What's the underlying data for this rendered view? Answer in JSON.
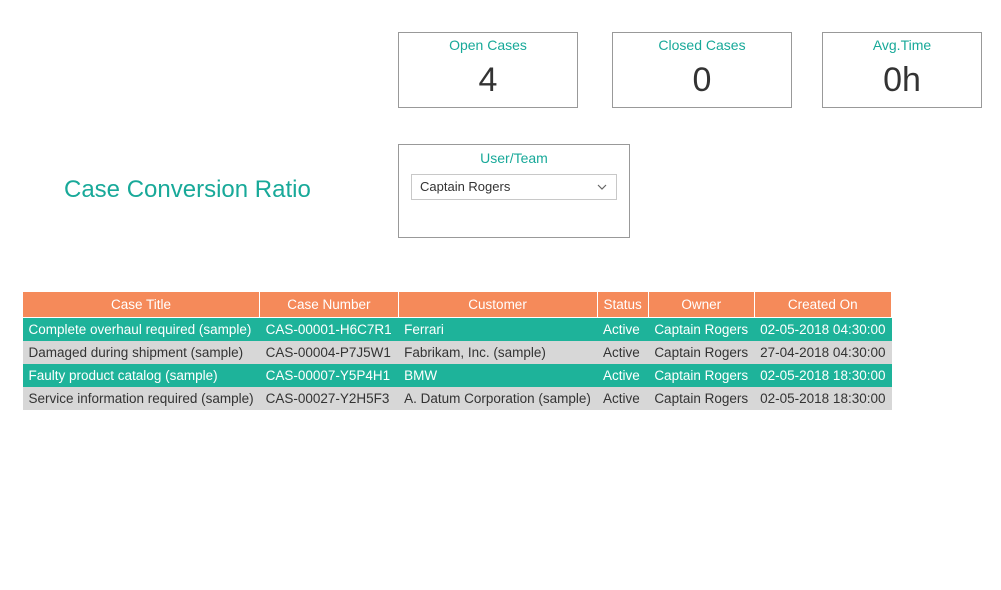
{
  "cards": {
    "open": {
      "label": "Open Cases",
      "value": "4"
    },
    "closed": {
      "label": "Closed Cases",
      "value": "0"
    },
    "avg": {
      "label": "Avg.Time",
      "value": "0h"
    }
  },
  "userteam": {
    "label": "User/Team",
    "selected": "Captain Rogers"
  },
  "title": "Case Conversion Ratio",
  "table": {
    "columns": [
      "Case Title",
      "Case Number",
      "Customer",
      "Status",
      "Owner",
      "Created On"
    ],
    "rows": [
      {
        "highlight": true,
        "cells": [
          "Complete overhaul required (sample)",
          "CAS-00001-H6C7R1",
          "Ferrari",
          "Active",
          "Captain Rogers",
          "02-05-2018 04:30:00"
        ]
      },
      {
        "highlight": false,
        "cells": [
          "Damaged during shipment (sample)",
          "CAS-00004-P7J5W1",
          "Fabrikam, Inc. (sample)",
          "Active",
          "Captain Rogers",
          "27-04-2018 04:30:00"
        ]
      },
      {
        "highlight": true,
        "cells": [
          "Faulty product catalog (sample)",
          "CAS-00007-Y5P4H1",
          "BMW",
          "Active",
          "Captain Rogers",
          "02-05-2018 18:30:00"
        ]
      },
      {
        "highlight": false,
        "cells": [
          "Service information required (sample)",
          "CAS-00027-Y2H5F3",
          "A. Datum Corporation (sample)",
          "Active",
          "Captain Rogers",
          "02-05-2018 18:30:00"
        ]
      }
    ]
  }
}
